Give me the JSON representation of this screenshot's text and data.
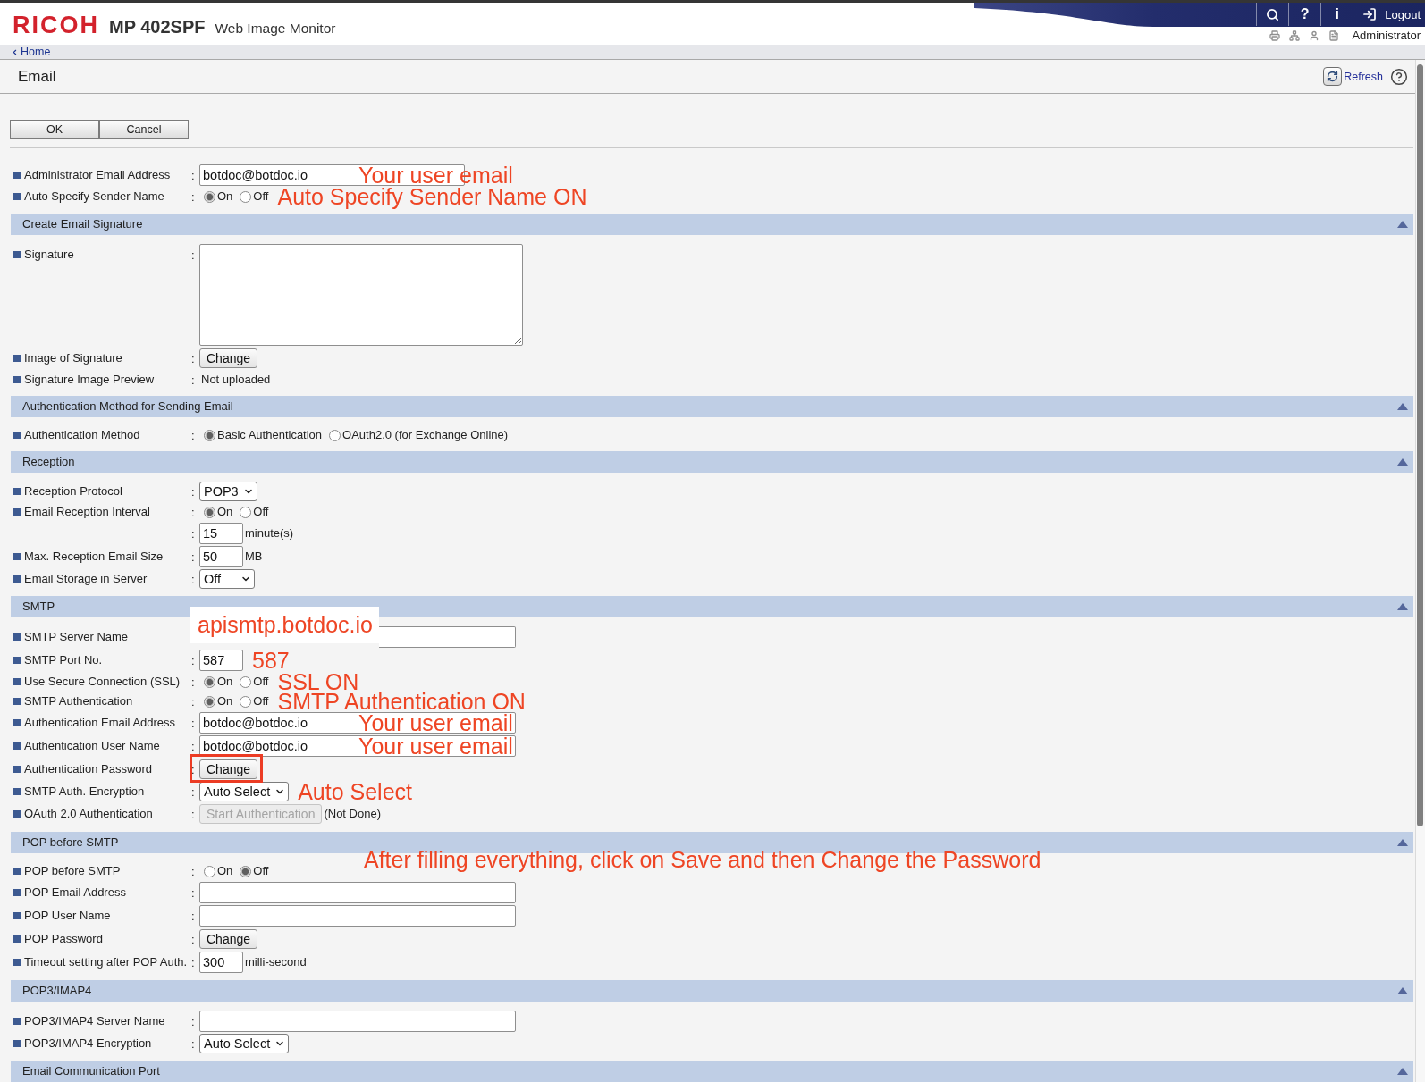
{
  "header": {
    "brand": "RICOH",
    "model": "MP 402SPF",
    "product": "Web Image Monitor",
    "help": "?",
    "info": "i",
    "logout": "Logout",
    "user": "Administrator"
  },
  "breadcrumb": "Home",
  "page": {
    "title": "Email",
    "refresh": "Refresh"
  },
  "actions": [
    "OK",
    "Cancel"
  ],
  "top_rows": [
    {
      "label": "Administrator Email Address",
      "separator": ":",
      "highlighted": false,
      "items": [
        {
          "kind": "input",
          "value": "botdoc@botdoc.io"
        }
      ],
      "annotation": {
        "kind": "overlay",
        "text": "Your user email"
      }
    },
    {
      "label": "Auto Specify Sender Name",
      "separator": ":",
      "highlighted": false,
      "items": [
        {
          "kind": "radio",
          "options": [
            {
              "label": "On",
              "selected": true
            },
            {
              "label": "Off",
              "selected": false
            }
          ]
        }
      ],
      "annotation": {
        "kind": "inline",
        "text": "Auto Specify Sender Name ON"
      }
    }
  ],
  "sections": [
    {
      "title": "Create Email Signature",
      "expanded": true,
      "rows": [
        {
          "label": "Signature",
          "separator": ":",
          "highlighted": false,
          "items": [
            {
              "kind": "textarea"
            }
          ]
        },
        {
          "label": "Image of Signature",
          "separator": ":",
          "highlighted": false,
          "items": [
            {
              "kind": "button",
              "label": "Change",
              "disabled": false
            }
          ]
        },
        {
          "label": "Signature Image Preview",
          "separator": ":",
          "highlighted": false,
          "items": [
            {
              "kind": "note",
              "text": "Not uploaded"
            }
          ]
        }
      ]
    },
    {
      "title": "Authentication Method for Sending Email",
      "expanded": true,
      "rows": [
        {
          "label": "Authentication Method",
          "separator": ":",
          "highlighted": false,
          "items": [
            {
              "kind": "radio",
              "options": [
                {
                  "label": "Basic Authentication",
                  "selected": true
                },
                {
                  "label": "OAuth2.0 (for Exchange Online)",
                  "selected": false
                }
              ]
            }
          ]
        }
      ]
    },
    {
      "title": "Reception",
      "expanded": true,
      "rows": [
        {
          "label": "Reception Protocol",
          "separator": ":",
          "highlighted": false,
          "items": [
            {
              "kind": "select",
              "value": "POP3"
            }
          ]
        },
        {
          "label": "Email Reception Interval",
          "separator": ":",
          "highlighted": false,
          "items": [
            {
              "kind": "radio",
              "options": [
                {
                  "label": "On",
                  "selected": true
                },
                {
                  "label": "Off",
                  "selected": false
                }
              ]
            }
          ]
        },
        {
          "separator": ":",
          "highlighted": false,
          "items": [
            {
              "kind": "short-input",
              "value": "15"
            },
            {
              "kind": "note",
              "text": "minute(s)"
            }
          ]
        },
        {
          "label": "Max. Reception Email Size",
          "separator": ":",
          "highlighted": false,
          "items": [
            {
              "kind": "short-input",
              "value": "50"
            },
            {
              "kind": "note",
              "text": "MB"
            }
          ]
        },
        {
          "label": "Email Storage in Server",
          "separator": ":",
          "highlighted": false,
          "items": [
            {
              "kind": "select",
              "value": "Off"
            }
          ]
        }
      ]
    },
    {
      "title": "SMTP",
      "expanded": true,
      "rows": [
        {
          "label": "SMTP Server Name",
          "highlighted": false,
          "items": [
            {
              "kind": "input"
            }
          ],
          "annotation": {
            "kind": "callout",
            "text": "apismtp.botdoc.io"
          }
        },
        {
          "label": "SMTP Port No.",
          "separator": ":",
          "highlighted": false,
          "items": [
            {
              "kind": "short-input",
              "value": "587"
            }
          ],
          "annotation": {
            "kind": "inline",
            "text": "587"
          }
        },
        {
          "label": "Use Secure Connection (SSL)",
          "separator": ":",
          "highlighted": false,
          "items": [
            {
              "kind": "radio",
              "options": [
                {
                  "label": "On",
                  "selected": true
                },
                {
                  "label": "Off",
                  "selected": false
                }
              ]
            }
          ],
          "annotation": {
            "kind": "inline",
            "text": "SSL ON"
          }
        },
        {
          "label": "SMTP Authentication",
          "separator": ":",
          "highlighted": false,
          "items": [
            {
              "kind": "radio",
              "options": [
                {
                  "label": "On",
                  "selected": true
                },
                {
                  "label": "Off",
                  "selected": false
                }
              ]
            }
          ],
          "annotation": {
            "kind": "inline",
            "text": "SMTP Authentication ON"
          }
        },
        {
          "label": "Authentication Email Address",
          "separator": ":",
          "highlighted": false,
          "items": [
            {
              "kind": "input",
              "value": "botdoc@botdoc.io"
            }
          ],
          "annotation": {
            "kind": "overlay",
            "text": "Your user email"
          }
        },
        {
          "label": "Authentication User Name",
          "separator": ":",
          "highlighted": false,
          "items": [
            {
              "kind": "input",
              "value": "botdoc@botdoc.io"
            }
          ],
          "annotation": {
            "kind": "overlay",
            "text": "Your user email"
          }
        },
        {
          "label": "Authentication Password",
          "separator": ":",
          "highlighted": true,
          "items": [
            {
              "kind": "button",
              "label": "Change",
              "disabled": false
            }
          ]
        },
        {
          "label": "SMTP Auth. Encryption",
          "separator": ":",
          "highlighted": false,
          "items": [
            {
              "kind": "select",
              "value": "Auto Select"
            }
          ],
          "annotation": {
            "kind": "inline",
            "text": "Auto Select"
          }
        },
        {
          "label": "OAuth 2.0 Authentication",
          "separator": ":",
          "highlighted": false,
          "items": [
            {
              "kind": "button",
              "label": "Start Authentication",
              "disabled": true
            },
            {
              "kind": "note",
              "text": "(Not Done)"
            }
          ]
        }
      ]
    },
    {
      "title": "POP before SMTP",
      "expanded": true,
      "rows": [
        {
          "label": "POP before SMTP",
          "separator": ":",
          "highlighted": false,
          "items": [
            {
              "kind": "radio",
              "options": [
                {
                  "label": "On",
                  "selected": false
                },
                {
                  "label": "Off",
                  "selected": true
                }
              ]
            }
          ],
          "annotation": {
            "kind": "instruction",
            "text": "After filling everything, click on Save and then Change the Password"
          }
        },
        {
          "label": "POP Email Address",
          "separator": ":",
          "highlighted": false,
          "items": [
            {
              "kind": "input"
            }
          ]
        },
        {
          "label": "POP User Name",
          "separator": ":",
          "highlighted": false,
          "items": [
            {
              "kind": "input"
            }
          ]
        },
        {
          "label": "POP Password",
          "separator": ":",
          "highlighted": false,
          "items": [
            {
              "kind": "button",
              "label": "Change",
              "disabled": false
            }
          ]
        },
        {
          "label": "Timeout setting after POP Auth.",
          "separator": ":",
          "highlighted": false,
          "items": [
            {
              "kind": "short-input",
              "value": "300"
            },
            {
              "kind": "note",
              "text": "milli-second"
            }
          ]
        }
      ]
    },
    {
      "title": "POP3/IMAP4",
      "expanded": true,
      "rows": [
        {
          "label": "POP3/IMAP4 Server Name",
          "separator": ":",
          "highlighted": false,
          "items": [
            {
              "kind": "input"
            }
          ]
        },
        {
          "label": "POP3/IMAP4 Encryption",
          "separator": ":",
          "highlighted": false,
          "items": [
            {
              "kind": "select",
              "value": "Auto Select"
            }
          ]
        }
      ]
    },
    {
      "title": "Email Communication Port",
      "expanded": true
    }
  ]
}
